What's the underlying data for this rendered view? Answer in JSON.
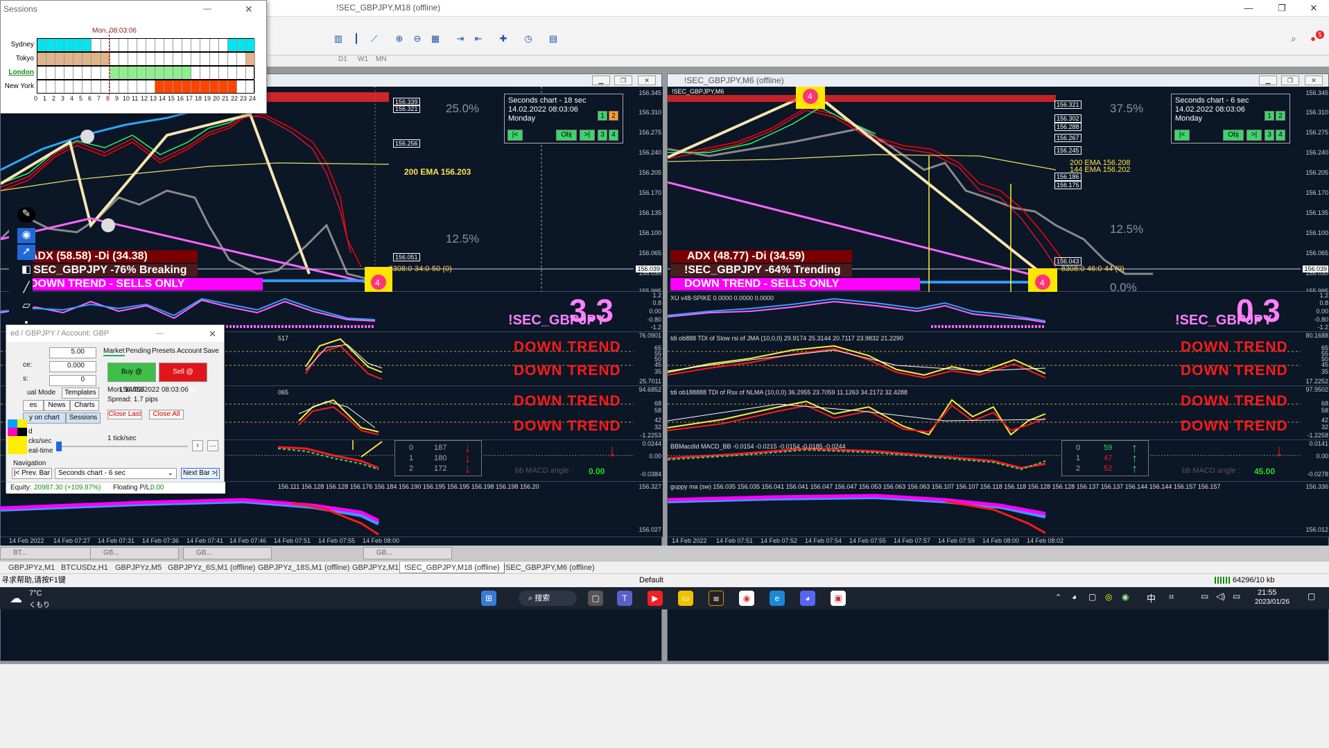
{
  "window": {
    "title": "!SEC_GBPJPY,M18 (offline)"
  },
  "toolbar": {
    "timeframes": [
      "D1",
      "W1",
      "MN"
    ]
  },
  "sessions": {
    "title": "Sessions",
    "time": "Mon, 08:03:06",
    "names": [
      "Sydney",
      "Tokyo",
      "London",
      "New York"
    ],
    "hours": [
      "0",
      "1",
      "2",
      "3",
      "4",
      "5",
      "6",
      "7",
      "8",
      "9",
      "10",
      "11",
      "12",
      "13",
      "14",
      "15",
      "16",
      "17",
      "18",
      "19",
      "20",
      "21",
      "22",
      "23",
      "24"
    ],
    "colors": {
      "sydney": "#00e6ee",
      "tokyo": "#e0b48a",
      "london": "#90ee90",
      "newyork": "#ff4500"
    }
  },
  "left": {
    "info": {
      "line1": "Seconds chart - 18 sec",
      "line2": "14.02.2022    08:03:06",
      "line3": "Monday",
      "btn_back": "|<",
      "btn_obj": "Obj",
      "btn_fwd": ">|",
      "nums": [
        "1",
        "2",
        "3",
        "4"
      ]
    },
    "prices_main": [
      "156.345",
      "156.310",
      "156.275",
      "156.240",
      "156.205",
      "156.170",
      "156.135",
      "156.100",
      "156.065",
      "156.030",
      "155.995"
    ],
    "price_tags": [
      "156.339",
      "156.321",
      "156.256",
      "156.051",
      "156.039"
    ],
    "pct_top": "25.0%",
    "pct_mid": "12.5%",
    "ema": "200 EMA 156.203",
    "order_line": "-8308:0-34:0-50 (0)",
    "adx": "ADX (58.58)  -Di (34.38)",
    "state": "!SEC_GBPJPY -76% Breaking",
    "trend": "DOWN TREND - SELLS ONLY",
    "big": "3.3",
    "sym": "!SEC_GBPJPY",
    "spike_label": "V48-SPIKE 0.0000 0.0000 0.0000",
    "spike_scale": [
      "1.2",
      "0.8",
      "0.00",
      "-0.80",
      "-1.2"
    ],
    "rsi1_label": "517",
    "rsi1_scale": [
      "76.0901",
      "65",
      "55",
      "50",
      "45",
      "35",
      "25.7011"
    ],
    "rsi2_label": "065",
    "rsi2_scale": [
      "94.6852",
      "68",
      "58",
      "42",
      "32",
      "-1.2253"
    ],
    "dtrend": "DOWN TREND",
    "macd_scale": [
      "0.0244",
      "0.00",
      "-0.0384"
    ],
    "macd_angle_label": "bb MACD angle :",
    "macd_angle": "0.00",
    "tbl": [
      [
        "0",
        "187"
      ],
      [
        "1",
        "180"
      ],
      [
        "2",
        "172"
      ]
    ],
    "guppy_prices": "156.111  156.128  156.128  156.176  156.184  156.190  156.195  156.195  156.198  156.198  156.20",
    "guppy_scale": [
      "156.327",
      "156.027"
    ],
    "dates": [
      "14 Feb 2022",
      "14 Feb 07:27",
      "14 Feb 07:31",
      "14 Feb 07:36",
      "14 Feb 07:41",
      "14 Feb 07:46",
      "14 Feb 07:51",
      "14 Feb 07:55",
      "14 Feb 08:00"
    ]
  },
  "right": {
    "title": "!SEC_GBPJPY,M6 (offline)",
    "header_label": "!SEC_GBPJPY,M6",
    "info": {
      "line1": "Seconds chart - 6 sec",
      "line2": "14.02.2022    08:03:06",
      "line3": "Monday",
      "btn_back": "|<",
      "btn_obj": "Obj",
      "btn_fwd": ">|",
      "nums": [
        "1",
        "2",
        "3",
        "4"
      ]
    },
    "prices_main": [
      "156.345",
      "156.310",
      "156.275",
      "156.240",
      "156.205",
      "156.170",
      "156.135",
      "156.100",
      "156.065",
      "156.030",
      "155.995"
    ],
    "price_tags": [
      "156.321",
      "156.302",
      "156.288",
      "156.267",
      "156.245",
      "156.186",
      "156.175",
      "156.043",
      "156.039"
    ],
    "pct_top": "37.5%",
    "pct_mid": "12.5%",
    "pct_bot": "0.0%",
    "ema": "200 EMA 156.208",
    "ema2": "144 EMA 156.202",
    "order_line": "-8308:0-46:0-44 (0)",
    "adx": "ADX (48.77)  -Di (34.59)",
    "state": "!SEC_GBPJPY -64% Trending",
    "trend": "DOWN TREND - SELLS ONLY",
    "big": "0.3",
    "sym": "!SEC_GBPJPY",
    "spike_label": "XU v48-SPIKE 0.0000 0.0000 0.0000",
    "spike_scale": [
      "1.2",
      "0.8",
      "0.00",
      "-0.80",
      "-1.2"
    ],
    "rsi1_label": "tdi ob888   TDI of Slow rsi of JMA (10,0,0) 29.9174 25.3144 20.7117 23.9832 21.2290",
    "rsi1_scale": [
      "80.1688",
      "65",
      "55",
      "50",
      "45",
      "35",
      "17.2252"
    ],
    "rsi2_label": "tdi ob188888   TDI of Rsx of NLMA (10,0,0) 36.2955 23.7059 11.1263 34.2172 32.4288",
    "rsi2_scale": [
      "97.9502",
      "68",
      "58",
      "42",
      "32",
      "-1.2258"
    ],
    "dtrend": "DOWN TREND",
    "macd_label": "BBMacdId MACD_BB -0.0154 -0.0215 -0.0154 -0.0185 -0.0244",
    "macd_scale": [
      "0.0141",
      "0.00",
      "-0.0278"
    ],
    "macd_angle_label": "bb MACD angle :",
    "macd_angle": "45.00",
    "tbl": [
      [
        "0",
        "59"
      ],
      [
        "1",
        "47"
      ],
      [
        "2",
        "52"
      ]
    ],
    "guppy_label": "guppy ma (sw)  156.035  156.035  156.041  156.041  156.047  156.047  156.053  156.063  156.063  156.107  156.107  156.118  156.118  156.128  156.128  156.137  156.137  156.144  156.144  156.157  156.157",
    "guppy_scale": [
      "156.336",
      "156.012"
    ],
    "dates": [
      "14 Feb 2022",
      "14 Feb 07:51",
      "14 Feb 07:52",
      "14 Feb 07:54",
      "14 Feb 07:55",
      "14 Feb 07:57",
      "14 Feb 07:59",
      "14 Feb 08:00",
      "14 Feb 08:02"
    ]
  },
  "trade": {
    "title": "ed / GBPJPY / Account: GBP",
    "tabs": [
      "Market",
      "Pending",
      "Presets",
      "Account",
      "Save"
    ],
    "lots": "5.00",
    "field2": "0.000",
    "field3": "0",
    "lbl2": "ce:",
    "lbl3": "s:",
    "buy": "Buy @ 156.056",
    "sell": "Sell @ 156.039",
    "time": "Mon, 14/02/2022  08:03:06",
    "spread": "Spread:  1.7 pips",
    "close_last": "Close Last",
    "close_all": "Close All",
    "manual": "ual Mode",
    "templates": "Templates",
    "es": "es",
    "news": "News",
    "charts": "Charts",
    "on_chart": "y on chart",
    "sessions": "Sessions",
    "speed_top": "1 tick/sec",
    "ticks_lbl": "cks/sec",
    "real_lbl": "eal-time",
    "d_lbl": "d",
    "nav_label": "Navigation",
    "prev": "|< Prev. Bar",
    "chart_sel": "Seconds chart - 6 sec",
    "next": "Next Bar >|",
    "equity_lbl": "Equity:",
    "equity": "20987.30  (+109.87%)",
    "pl_lbl": "Floating P/L:",
    "pl": "0.00"
  },
  "mdi_tabs": [
    "BT...",
    "GB...",
    "GB...",
    "GB..."
  ],
  "chart_tabs": [
    "GBPJPYz,M1",
    "BTCUSDz,H1",
    "GBPJPYz,M5",
    "GBPJPYz_6S,M1 (offline)",
    "GBPJPYz_18S,M1 (offline)",
    "GBPJPYz,M1",
    "!SEC_GBPJPY,M18 (offline)",
    "!SEC_GBPJPY,M6 (offline)"
  ],
  "status": {
    "help": "寻求帮助,请按F1键",
    "profile": "Default",
    "traffic": "64296/10 kb"
  },
  "taskbar": {
    "temp": "7°C",
    "weather": "くもり",
    "search": "搜索",
    "ime": "中",
    "time": "21:55",
    "date": "2023/01/26",
    "badge": "5"
  }
}
